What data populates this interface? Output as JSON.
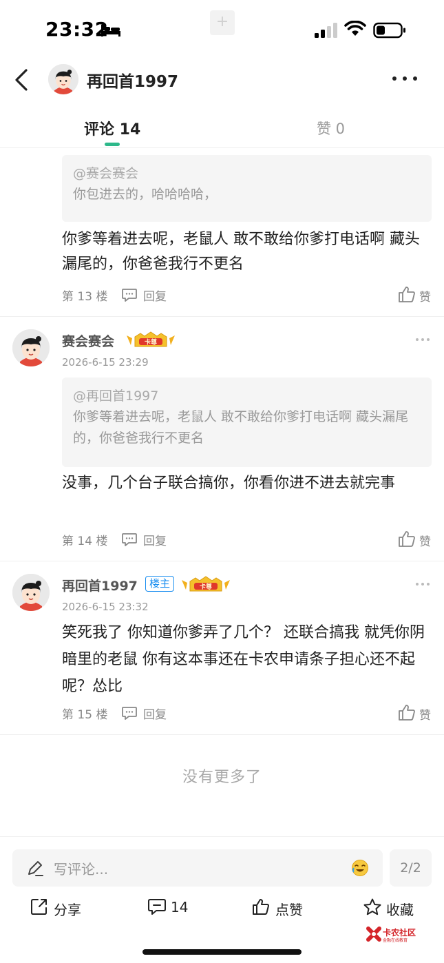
{
  "status_bar": {
    "time": "23:32",
    "notch_plus": "+"
  },
  "nav": {
    "title": "再回首1997"
  },
  "tabs": {
    "comments": "评论 14",
    "likes": "赞 0"
  },
  "comments": [
    {
      "quote_user": "@赛会赛会",
      "quote_text": "你包进去的，哈哈哈哈，",
      "body": "你爹等着进去呢，老鼠人 敢不敢给你爹打电话啊 藏头漏尾的，你爸爸我行不更名",
      "floor": "第 13 楼",
      "reply": "回复",
      "like": "赞"
    },
    {
      "author": "赛会赛会",
      "vip_badge": "卡尊",
      "time": "2026-6-15 23:29",
      "quote_user": "@再回首1997",
      "quote_text": "你爹等着进去呢，老鼠人 敢不敢给你爹打电话啊 藏头漏尾的，你爸爸我行不更名",
      "body": "没事，几个台子联合搞你，你看你进不进去就完事",
      "floor": "第 14 楼",
      "reply": "回复",
      "like": "赞"
    },
    {
      "author": "再回首1997",
      "owner_badge": "楼主",
      "vip_badge": "卡尊",
      "time": "2026-6-15 23:32",
      "body": "笑死我了 你知道你爹弄了几个？ 还联合搞我 就凭你阴暗里的老鼠 你有这本事还在卡农申请条子担心还不起呢？怂比",
      "floor": "第 15 楼",
      "reply": "回复",
      "like": "赞"
    }
  ],
  "no_more": "没有更多了",
  "bottom": {
    "input_placeholder": "写评论...",
    "page_indicator": "2/2",
    "share": "分享",
    "comment_count": "14",
    "like": "点赞",
    "favorite": "收藏",
    "watermark_name": "卡农社区",
    "watermark_sub": "金融在线教育"
  },
  "colors": {
    "accent": "#2db88a",
    "owner_badge": "#1a8ef0",
    "watermark": "#d4252a"
  },
  "icons": [
    "back-icon",
    "more-icon",
    "kebab-icon",
    "reply-icon",
    "thumb-up-icon",
    "pen-icon",
    "emoji-icon",
    "share-icon",
    "comment-icon",
    "star-icon"
  ]
}
